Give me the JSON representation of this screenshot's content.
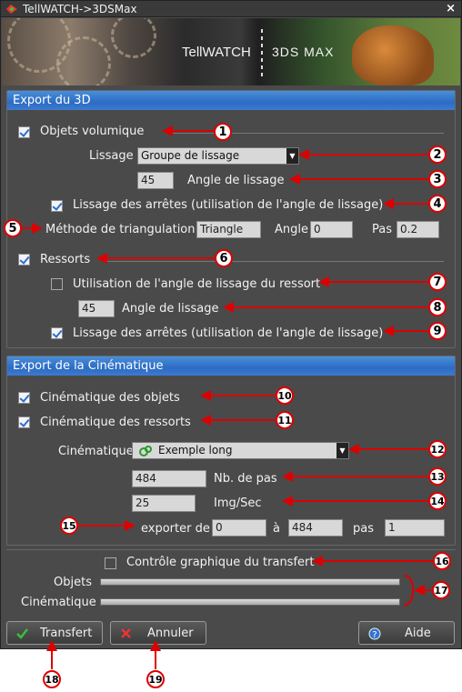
{
  "window": {
    "title": "TellWATCH->3DSMax",
    "close_label": "×"
  },
  "banner": {
    "left_text": "TellWATCH",
    "right_text": "3DS MAX"
  },
  "export3d": {
    "header": "Export du 3D",
    "objets_volumique": "Objets volumique",
    "lissage_label": "Lissage",
    "lissage_value": "Groupe de lissage",
    "angle_value": "45",
    "angle_label": "Angle de lissage",
    "lissage_arretes": "Lissage des arrêtes (utilisation de l'angle de lissage)",
    "methode_label": "Méthode de triangulation",
    "methode_value": "Triangle",
    "angle2_label": "Angle",
    "angle2_value": "0",
    "pas_label": "Pas",
    "pas_value": "0.2",
    "ressorts": "Ressorts",
    "utilisation_angle": "Utilisation de l'angle de lissage du ressort",
    "angle_ressort_value": "45",
    "angle_ressort_label": "Angle de lissage",
    "lissage_arretes2": "Lissage des arrêtes (utilisation de l'angle de lissage)"
  },
  "cinematique": {
    "header": "Export de la Cinématique",
    "objets": "Cinématique des objets",
    "ressorts": "Cinématique des ressorts",
    "cine_label": "Cinématique",
    "cine_value": "Exemple long",
    "nb_value": "484",
    "nb_label": "Nb. de pas",
    "img_value": "25",
    "img_label": "Img/Sec",
    "exporter_label": "exporter de",
    "from_value": "0",
    "a_label": "à",
    "to_value": "484",
    "pas_label": "pas",
    "pas_value": "1"
  },
  "transfer": {
    "controle": "Contrôle graphique du transfert",
    "objets_label": "Objets",
    "cine_label": "Cinématique"
  },
  "buttons": {
    "transfert": "Transfert",
    "annuler": "Annuler",
    "aide": "Aide"
  },
  "annotations": [
    "1",
    "2",
    "3",
    "4",
    "5",
    "6",
    "7",
    "8",
    "9",
    "10",
    "11",
    "12",
    "13",
    "14",
    "15",
    "16",
    "17",
    "18",
    "19"
  ],
  "colors": {
    "annotation": "#dd0000",
    "header": "#2c6cc4",
    "check": "#2a6fd6"
  }
}
